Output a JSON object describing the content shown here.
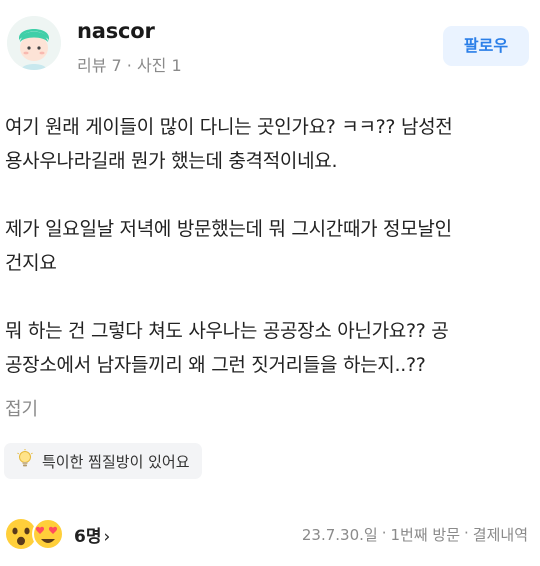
{
  "user": {
    "name": "nascor",
    "meta": "리뷰 7 · 사진 1",
    "follow_label": "팔로우"
  },
  "review": {
    "paragraphs": [
      "여기 원래 게이들이 많이 다니는 곳인가요? ㅋㅋ?? 남성전\n용사우나라길래 뭔가 했는데 충격적이네요.",
      "제가 일요일날 저녁에 방문했는데 뭐 그시간때가 정모날인\n건지요",
      "뭐 하는 건 그렇다 쳐도 사우나는 공공장소 아닌가요?? 공\n공장소에서 남자들끼리 왜 그런 짓거리들을 하는지..??"
    ],
    "fold_label": "접기"
  },
  "tag": {
    "icon": "lightbulb-icon",
    "label": "특이한 찜질방이 있어요"
  },
  "footer": {
    "reaction_count": "6명",
    "date": "23.7.30.일",
    "visit": "1번째 방문",
    "payment": "결제내역"
  },
  "colors": {
    "accent": "#2b7fe8",
    "follow_bg": "#eaf3ff",
    "muted": "#8a8a8a"
  }
}
